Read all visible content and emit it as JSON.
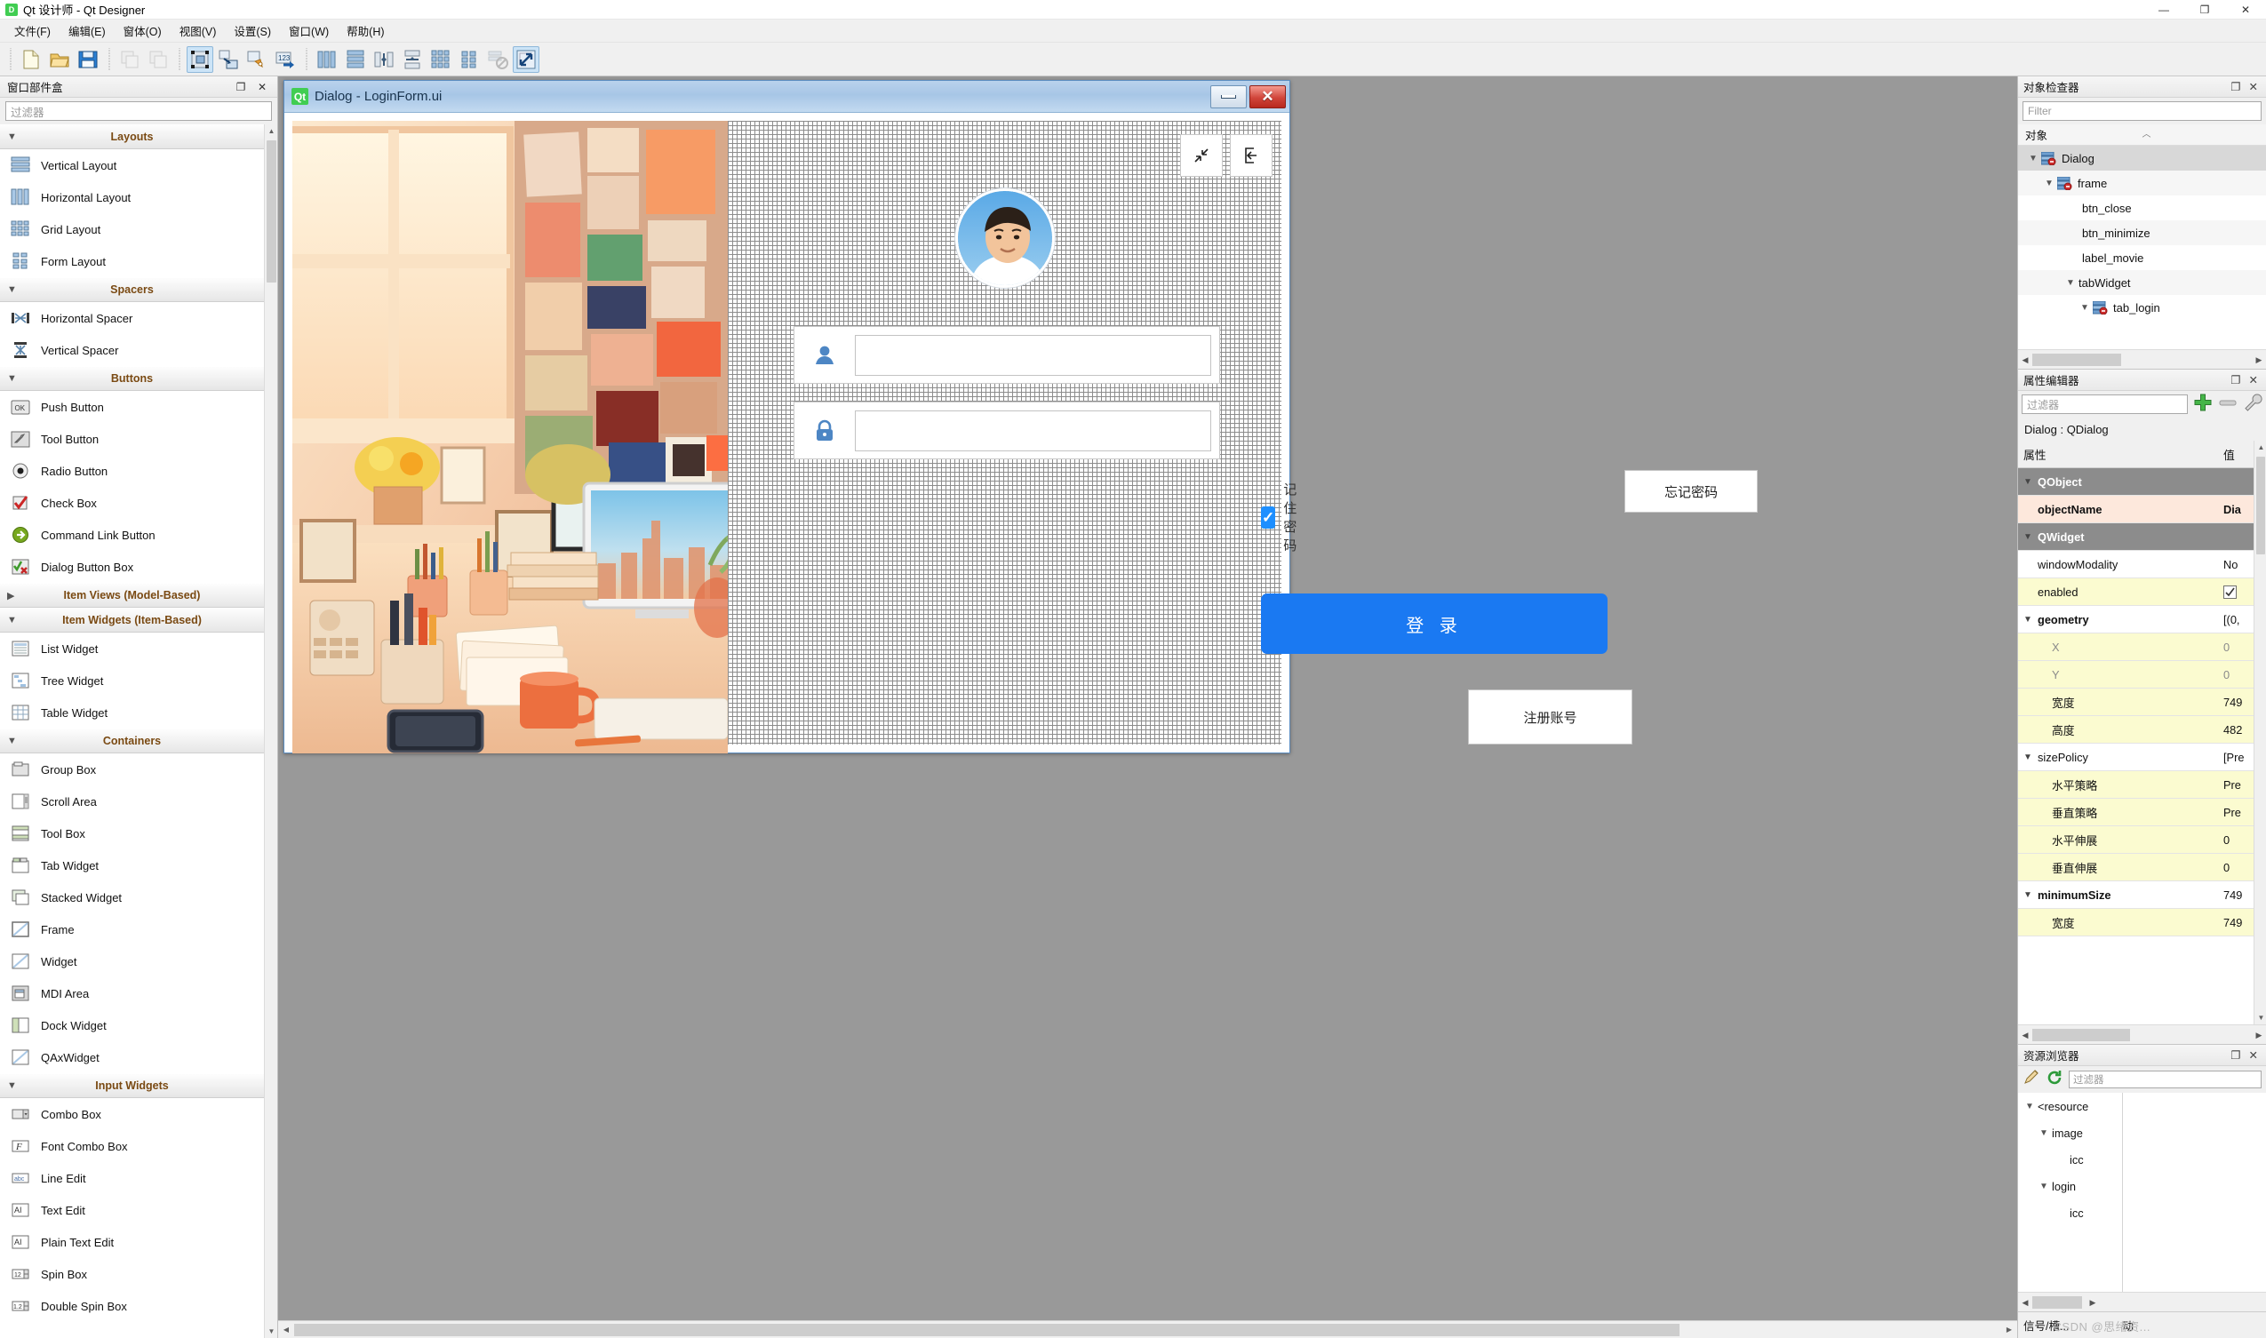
{
  "window": {
    "title": "Qt 设计师 - Qt Designer",
    "app_icon": "D",
    "minimize": "—",
    "maximize": "❐",
    "close": "✕"
  },
  "menubar": {
    "items": [
      {
        "label": "文件(F)",
        "name": "menu-file"
      },
      {
        "label": "编辑(E)",
        "name": "menu-edit"
      },
      {
        "label": "窗体(O)",
        "name": "menu-form"
      },
      {
        "label": "视图(V)",
        "name": "menu-view"
      },
      {
        "label": "设置(S)",
        "name": "menu-settings"
      },
      {
        "label": "窗口(W)",
        "name": "menu-window"
      },
      {
        "label": "帮助(H)",
        "name": "menu-help"
      }
    ]
  },
  "toolbar": {
    "buttons": [
      {
        "name": "new-form-icon",
        "title": "新建"
      },
      {
        "name": "open-form-icon",
        "title": "打开"
      },
      {
        "name": "save-form-icon",
        "title": "保存"
      },
      {
        "name": "undo-icon",
        "title": "撤销"
      },
      {
        "name": "redo-icon",
        "title": "重做"
      },
      {
        "name": "edit-widgets-icon",
        "title": "编辑窗口部件"
      },
      {
        "name": "edit-signals-icon",
        "title": "编辑信号/槽"
      },
      {
        "name": "edit-buddies-icon",
        "title": "编辑伙伴"
      },
      {
        "name": "edit-taborder-icon",
        "title": "编辑Tab顺序"
      },
      {
        "name": "layout-horizontal-icon",
        "title": "水平布局"
      },
      {
        "name": "layout-vertical-icon",
        "title": "垂直布局"
      },
      {
        "name": "layout-splitter-h-icon",
        "title": "水平分裂器布局"
      },
      {
        "name": "layout-splitter-v-icon",
        "title": "垂直分裂器布局"
      },
      {
        "name": "layout-grid-icon",
        "title": "栅格布局"
      },
      {
        "name": "layout-form-icon",
        "title": "窗体布局"
      },
      {
        "name": "break-layout-icon",
        "title": "打破布局"
      },
      {
        "name": "adjust-size-icon",
        "title": "调整大小"
      }
    ]
  },
  "widgetbox": {
    "title": "窗口部件盒",
    "float_icon": "❐",
    "close_icon": "✕",
    "filter_placeholder": "过滤器",
    "groups": [
      {
        "label": "Layouts",
        "expanded": true,
        "items": [
          {
            "label": "Vertical Layout",
            "icon": "vertical-layout-icon"
          },
          {
            "label": "Horizontal Layout",
            "icon": "horizontal-layout-icon"
          },
          {
            "label": "Grid Layout",
            "icon": "grid-layout-icon"
          },
          {
            "label": "Form Layout",
            "icon": "form-layout-icon"
          }
        ]
      },
      {
        "label": "Spacers",
        "expanded": true,
        "items": [
          {
            "label": "Horizontal Spacer",
            "icon": "horizontal-spacer-icon"
          },
          {
            "label": "Vertical Spacer",
            "icon": "vertical-spacer-icon"
          }
        ]
      },
      {
        "label": "Buttons",
        "expanded": true,
        "items": [
          {
            "label": "Push Button",
            "icon": "push-button-icon"
          },
          {
            "label": "Tool Button",
            "icon": "tool-button-icon"
          },
          {
            "label": "Radio Button",
            "icon": "radio-button-icon"
          },
          {
            "label": "Check Box",
            "icon": "check-box-icon"
          },
          {
            "label": "Command Link Button",
            "icon": "command-link-button-icon"
          },
          {
            "label": "Dialog Button Box",
            "icon": "dialog-button-box-icon"
          }
        ]
      },
      {
        "label": "Item Views (Model-Based)",
        "expanded": false,
        "items": []
      },
      {
        "label": "Item Widgets (Item-Based)",
        "expanded": true,
        "items": [
          {
            "label": "List Widget",
            "icon": "list-widget-icon"
          },
          {
            "label": "Tree Widget",
            "icon": "tree-widget-icon"
          },
          {
            "label": "Table Widget",
            "icon": "table-widget-icon"
          }
        ]
      },
      {
        "label": "Containers",
        "expanded": true,
        "items": [
          {
            "label": "Group Box",
            "icon": "group-box-icon"
          },
          {
            "label": "Scroll Area",
            "icon": "scroll-area-icon"
          },
          {
            "label": "Tool Box",
            "icon": "tool-box-icon"
          },
          {
            "label": "Tab Widget",
            "icon": "tab-widget-icon"
          },
          {
            "label": "Stacked Widget",
            "icon": "stacked-widget-icon"
          },
          {
            "label": "Frame",
            "icon": "frame-icon"
          },
          {
            "label": "Widget",
            "icon": "widget-icon"
          },
          {
            "label": "MDI Area",
            "icon": "mdi-area-icon"
          },
          {
            "label": "Dock Widget",
            "icon": "dock-widget-icon"
          },
          {
            "label": "QAxWidget",
            "icon": "qax-widget-icon"
          }
        ]
      },
      {
        "label": "Input Widgets",
        "expanded": true,
        "items": [
          {
            "label": "Combo Box",
            "icon": "combo-box-icon"
          },
          {
            "label": "Font Combo Box",
            "icon": "font-combo-box-icon"
          },
          {
            "label": "Line Edit",
            "icon": "line-edit-icon"
          },
          {
            "label": "Text Edit",
            "icon": "text-edit-icon"
          },
          {
            "label": "Plain Text Edit",
            "icon": "plain-text-edit-icon"
          },
          {
            "label": "Spin Box",
            "icon": "spin-box-icon"
          },
          {
            "label": "Double Spin Box",
            "icon": "double-spin-box-icon"
          }
        ]
      }
    ]
  },
  "form": {
    "window_title": "Dialog - LoginForm.ui",
    "qt_icon_text": "Qt",
    "minimize_title": "btn_minimize",
    "close_title": "btn_close",
    "panel": {
      "collapse_icon": "collapse-icon",
      "exit_icon": "exit-icon",
      "avatar_name": "avatar",
      "username_placeholder": "",
      "username_value": "",
      "password_placeholder": "",
      "password_value": "",
      "remember_label": "记住密码",
      "remember_checked": true,
      "forgot_label": "忘记密码",
      "login_label": "登 录",
      "register_label": "注册账号"
    }
  },
  "object_inspector": {
    "title": "对象检查器",
    "float_icon": "❐",
    "close_icon": "✕",
    "filter_placeholder": "Filter",
    "column_header": "对象",
    "nodes": [
      {
        "label": "Dialog",
        "depth": 0,
        "chevron": "▼",
        "icon": true,
        "selected": true
      },
      {
        "label": "frame",
        "depth": 1,
        "chevron": "▼",
        "icon": true,
        "selected": false
      },
      {
        "label": "btn_close",
        "depth": 2,
        "chevron": "",
        "icon": false,
        "selected": false
      },
      {
        "label": "btn_minimize",
        "depth": 2,
        "chevron": "",
        "icon": false,
        "selected": false
      },
      {
        "label": "label_movie",
        "depth": 2,
        "chevron": "",
        "icon": false,
        "selected": false
      },
      {
        "label": "tabWidget",
        "depth": 2,
        "chevron": "▼",
        "icon": false,
        "selected": false
      },
      {
        "label": "tab_login",
        "depth": 3,
        "chevron": "▼",
        "icon": true,
        "selected": false
      }
    ]
  },
  "property_editor": {
    "title": "属性编辑器",
    "float_icon": "❐",
    "close_icon": "✕",
    "filter_placeholder": "过滤器",
    "add_icon": "+",
    "remove_icon": "—",
    "config_icon": "wrench-icon",
    "object_line": "Dialog : QDialog",
    "col_property": "属性",
    "col_value": "值",
    "rows": [
      {
        "name": "QObject",
        "value": "",
        "style": "group",
        "indent": 0,
        "chevron": "▼"
      },
      {
        "name": "objectName",
        "value": "Dia",
        "style": "peach",
        "indent": 1,
        "chevron": ""
      },
      {
        "name": "QWidget",
        "value": "",
        "style": "group",
        "indent": 0,
        "chevron": "▼"
      },
      {
        "name": "windowModality",
        "value": "No",
        "style": "plain",
        "indent": 1,
        "chevron": ""
      },
      {
        "name": "enabled",
        "value": "checkbox",
        "style": "yellow",
        "indent": 1,
        "chevron": ""
      },
      {
        "name": "geometry",
        "value": "[(0,",
        "style": "bold",
        "indent": 0,
        "chevron": "▼"
      },
      {
        "name": "X",
        "value": "0",
        "style": "yellow-gray",
        "indent": 2,
        "chevron": ""
      },
      {
        "name": "Y",
        "value": "0",
        "style": "yellow-gray",
        "indent": 2,
        "chevron": ""
      },
      {
        "name": "宽度",
        "value": "749",
        "style": "yellow",
        "indent": 2,
        "chevron": ""
      },
      {
        "name": "高度",
        "value": "482",
        "style": "yellow",
        "indent": 2,
        "chevron": ""
      },
      {
        "name": "sizePolicy",
        "value": "[Pre",
        "style": "plain",
        "indent": 0,
        "chevron": "▼"
      },
      {
        "name": "水平策略",
        "value": "Pre",
        "style": "yellow",
        "indent": 2,
        "chevron": ""
      },
      {
        "name": "垂直策略",
        "value": "Pre",
        "style": "yellow",
        "indent": 2,
        "chevron": ""
      },
      {
        "name": "水平伸展",
        "value": "0",
        "style": "yellow",
        "indent": 2,
        "chevron": ""
      },
      {
        "name": "垂直伸展",
        "value": "0",
        "style": "yellow",
        "indent": 2,
        "chevron": ""
      },
      {
        "name": "minimumSize",
        "value": "749",
        "style": "bold",
        "indent": 0,
        "chevron": "▼"
      },
      {
        "name": "宽度",
        "value": "749",
        "style": "yellow",
        "indent": 2,
        "chevron": ""
      }
    ]
  },
  "resource_browser": {
    "title": "资源浏览器",
    "float_icon": "❐",
    "close_icon": "✕",
    "edit_icon": "pencil-icon",
    "reload_icon": "reload-icon",
    "filter_placeholder": "过滤器",
    "nodes": [
      {
        "label": "<resource",
        "depth": 0,
        "chevron": "▼"
      },
      {
        "label": "image",
        "depth": 1,
        "chevron": "▼"
      },
      {
        "label": "icc",
        "depth": 2,
        "chevron": ""
      },
      {
        "label": "login",
        "depth": 1,
        "chevron": "▼"
      },
      {
        "label": "icc",
        "depth": 2,
        "chevron": ""
      }
    ]
  },
  "status": {
    "signal_slot_title": "信号/槽...",
    "action_label": "动",
    "watermark": "CSDN @思绪资..."
  }
}
